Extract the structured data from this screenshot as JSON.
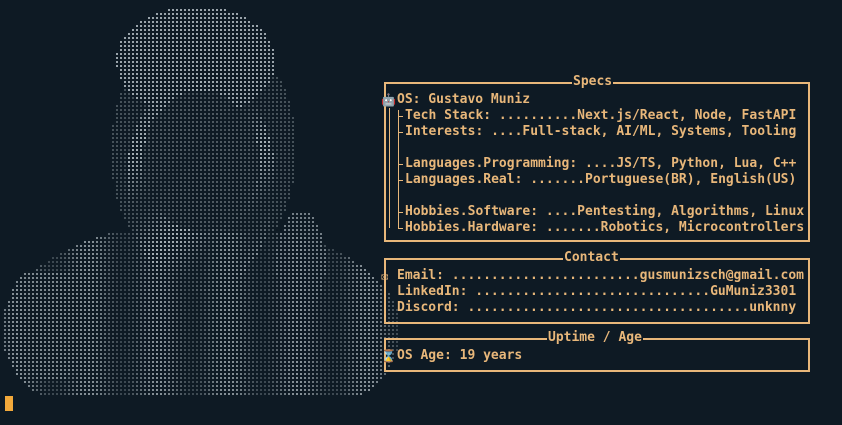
{
  "theme": {
    "background": "#0e1a24",
    "accent": "#e8b77a",
    "portrait_color": "#c9d3d8",
    "cursor_color": "#f2a93b"
  },
  "specs": {
    "title": "Specs",
    "os_icon": "robot-icon",
    "os": "OS: Gustavo Muniz",
    "rows": [
      "Tech Stack: ..........Next.js/React, Node, FastAPI",
      "Interests: ....Full-stack, AI/ML, Systems, Tooling",
      "",
      "Languages.Programming: ....JS/TS, Python, Lua, C++",
      "Languages.Real: .......Portuguese(BR), English(US)",
      "",
      "Hobbies.Software: ....Pentesting, Algorithms, Linux",
      "Hobbies.Hardware: .......Robotics, Microcontrollers"
    ]
  },
  "contact": {
    "title": "Contact",
    "email_icon": "envelope-icon",
    "rows": [
      "Email: ........................gusmunizsch@gmail.com",
      "LinkedIn: ..............................GuMuniz3301",
      "Discord: ....................................unknny"
    ]
  },
  "uptime": {
    "title": "Uptime / Age",
    "icon": "hourglass-icon",
    "row": "OS Age: 19 years"
  }
}
